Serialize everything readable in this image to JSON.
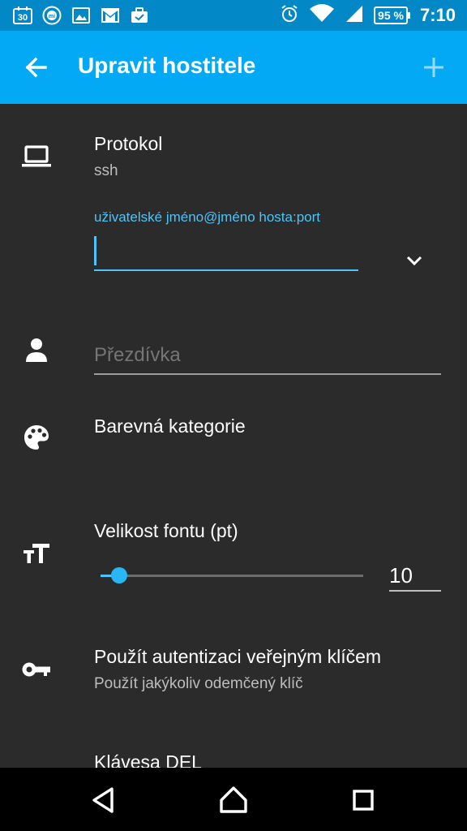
{
  "status_bar": {
    "notification_icons": [
      "calendar-icon",
      "mi-icon",
      "gallery-icon",
      "gmail-icon",
      "briefcase-icon"
    ],
    "calendar_day": "30",
    "battery": "95 %",
    "time": "7:10"
  },
  "app_bar": {
    "title": "Upravit hostitele",
    "back_icon": "arrow-back-icon",
    "add_icon": "plus-icon"
  },
  "protocol": {
    "label": "Protokol",
    "value": "ssh",
    "address_hint": "uživatelské jméno@jméno hosta:port",
    "address_value": ""
  },
  "nickname": {
    "placeholder": "Přezdívka"
  },
  "color_category": {
    "label": "Barevná kategorie"
  },
  "font_size": {
    "label": "Velikost fontu (pt)",
    "value": "10",
    "slider_fraction": 0.07
  },
  "pubkey": {
    "label": "Použít autentizaci veřejným klíčem",
    "value": "Použít jakýkoliv odemčený klíč"
  },
  "del_key": {
    "label": "Klávesa DEL"
  },
  "colors": {
    "accent": "#4fc3f7",
    "app_bar": "#03a9f4",
    "status_bar": "#0288c7",
    "background": "#2b2b2b"
  }
}
